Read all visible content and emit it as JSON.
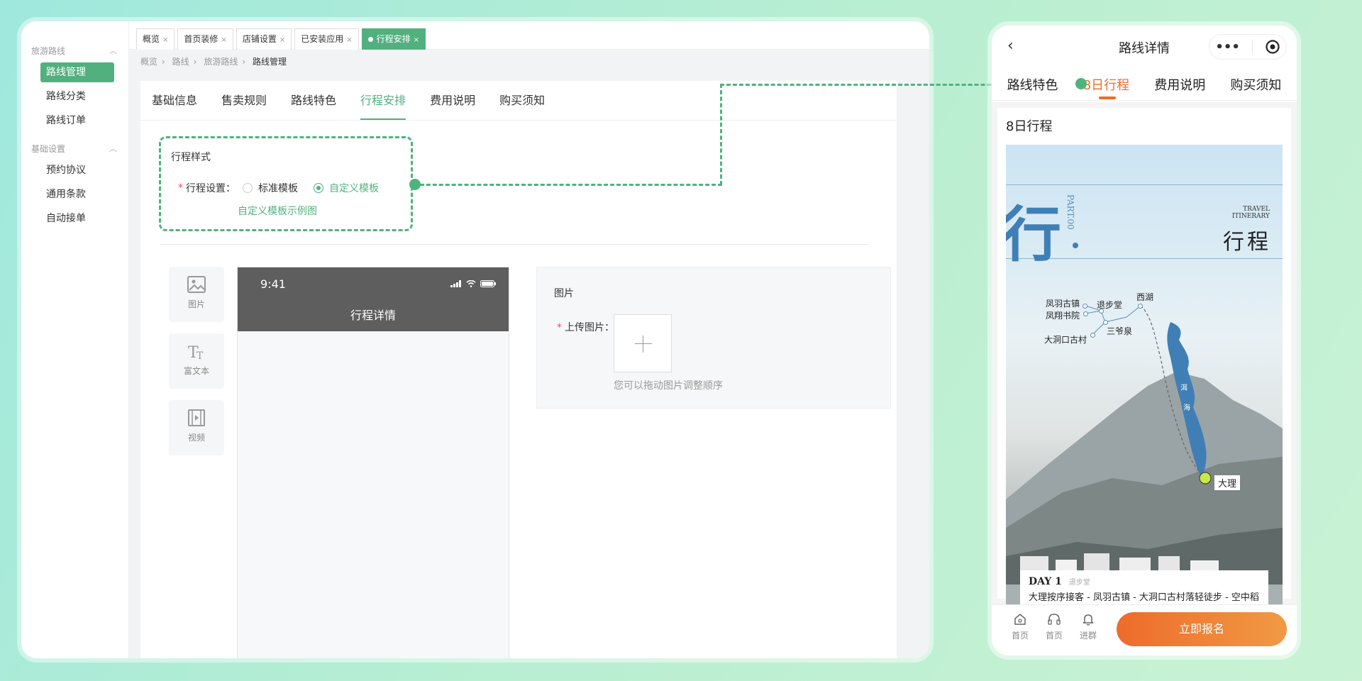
{
  "sidebar": {
    "groups": [
      {
        "label": "旅游路线",
        "items": [
          "路线管理",
          "路线分类",
          "路线订单"
        ]
      },
      {
        "label": "基础设置",
        "items": [
          "预约协议",
          "通用条款",
          "自动接单"
        ]
      }
    ]
  },
  "tabs": [
    "概览",
    "首页装修",
    "店铺设置",
    "已安装应用",
    "行程安排"
  ],
  "breadcrumb": [
    "概览",
    "路线",
    "旅游路线",
    "路线管理"
  ],
  "subtabs": [
    "基础信息",
    "售卖规则",
    "路线特色",
    "行程安排",
    "费用说明",
    "购买须知"
  ],
  "itinerary_style": {
    "title": "行程样式",
    "setting_label": "行程设置：",
    "option_standard": "标准模板",
    "option_custom": "自定义模板",
    "example_link": "自定义模板示例图"
  },
  "widgets": [
    "图片",
    "富文本",
    "视频"
  ],
  "preview": {
    "time": "9:41",
    "title": "行程详情"
  },
  "image_panel": {
    "title": "图片",
    "upload_label": "上传图片：",
    "hint": "您可以拖动图片调整顺序"
  },
  "mobile": {
    "title": "路线详情",
    "tabs": [
      "路线特色",
      "8日行程",
      "费用说明",
      "购买须知"
    ],
    "section_title": "8日行程",
    "poster": {
      "big_char": "行",
      "part": "PART.00",
      "travel_line1": "TRAVEL",
      "travel_line2": "ITINERARY",
      "heading": "行程",
      "places": [
        "凤羽古镇",
        "凤翔书院",
        "退步堂",
        "西湖",
        "三爷泉",
        "大洞口古村"
      ],
      "lake_char1": "洱",
      "lake_char2": "海",
      "dali": "大理"
    },
    "day": {
      "label": "DAY 1",
      "sub": "退步堂",
      "desc": "大理按序接客 - 凤羽古镇 - 大洞口古村落轻徒步 - 空中稻田 - 可丕馆"
    },
    "footer": [
      "首页",
      "首页",
      "进群"
    ],
    "cta": "立即报名"
  },
  "colors": {
    "accent": "#52b07e",
    "orange": "#ef6b2a",
    "lake": "#3f7fb5"
  }
}
